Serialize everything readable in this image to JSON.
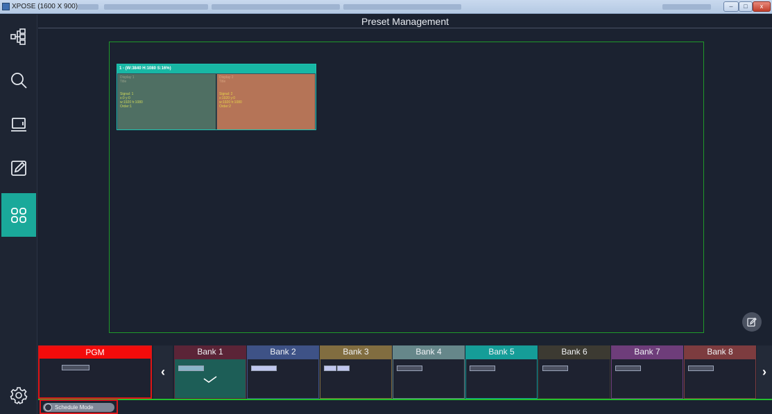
{
  "window": {
    "title": "XPOSE (1600 X 900)"
  },
  "header": {
    "title": "Preset Management"
  },
  "sidebar": {
    "items": [
      {
        "name": "topology-icon"
      },
      {
        "name": "search-icon"
      },
      {
        "name": "display-icon"
      },
      {
        "name": "edit-icon"
      },
      {
        "name": "preset-grid-icon",
        "active": true
      },
      {
        "name": "settings-icon"
      }
    ]
  },
  "layout": {
    "header": "1 - (W:3840 H:1080 S:16%)",
    "windows": [
      {
        "line1": "Display 1",
        "line2": "Title",
        "signal": "Signal: 1",
        "pos": "x:0  y:0",
        "size": "w:1920  h:1080",
        "order": "Order:1"
      },
      {
        "line1": "Display 2",
        "line2": "Title",
        "signal": "Signal: 2",
        "pos": "x:1920  y:0",
        "size": "w:1920  h:1080",
        "order": "Order:2"
      }
    ]
  },
  "pgm": {
    "label": "PGM"
  },
  "nav": {
    "prev": "‹",
    "next": "›"
  },
  "banks": [
    {
      "label": "Bank 1",
      "color": "#5b2437",
      "body_color": "#1d5e57",
      "selected": true,
      "bars": 1
    },
    {
      "label": "Bank 2",
      "color": "#3e5286",
      "bars": 1
    },
    {
      "label": "Bank 3",
      "color": "#816d40",
      "bars": 2
    },
    {
      "label": "Bank 4",
      "color": "#66878a",
      "bars": 1
    },
    {
      "label": "Bank 5",
      "color": "#159d98",
      "bars": 1
    },
    {
      "label": "Bank 6",
      "color": "#3c3a32",
      "bars": 1
    },
    {
      "label": "Bank 7",
      "color": "#6e3d7a",
      "bars": 1
    },
    {
      "label": "Bank 8",
      "color": "#7d3c3f",
      "bars": 1
    }
  ],
  "schedule": {
    "label": "Schedule Mode"
  },
  "colors": {
    "accent": "#1aa99a",
    "pgm": "#f40b0b",
    "screen_border": "#1f9a2a",
    "status_line": "#23c12d"
  }
}
